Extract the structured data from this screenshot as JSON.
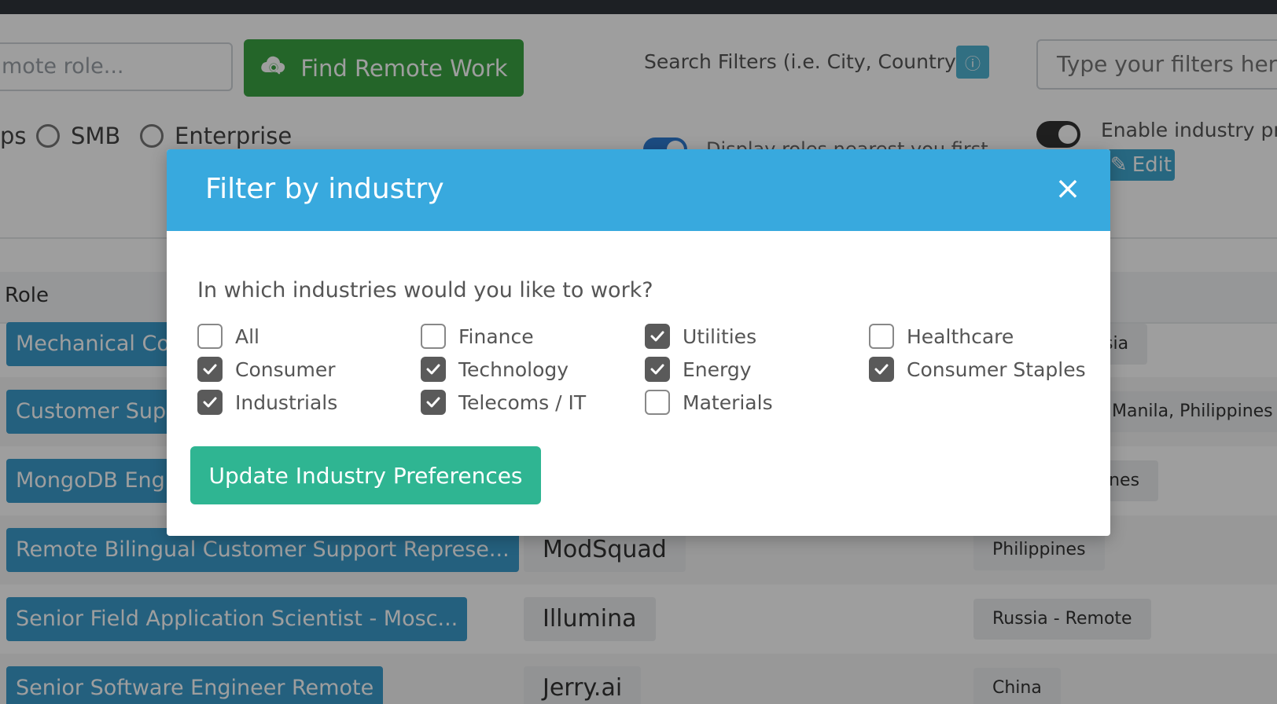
{
  "search": {
    "role_placeholder": "mote role...",
    "find_button": "Find Remote Work",
    "filters_label": "Search Filters (i.e. City, Country)",
    "filters_placeholder": "Type your filters here"
  },
  "company_size": {
    "partial_label": "ps",
    "options": [
      "SMB",
      "Enterprise"
    ]
  },
  "toggles": {
    "nearest_label": "Display roles nearest you first",
    "industry_pref_label": "Enable industry preferences",
    "edit_label": "Edit"
  },
  "table": {
    "header_role": "Role",
    "rows": [
      {
        "role": "Mechanical Con",
        "company": "",
        "location": "sia"
      },
      {
        "role": "Customer Supp",
        "company": "",
        "location": "Manila, Philippines"
      },
      {
        "role": "MongoDB Engi",
        "company": "",
        "location": "ines"
      },
      {
        "role": "Remote Bilingual Customer Support Represe...",
        "company": "ModSquad",
        "location": "Philippines"
      },
      {
        "role": "Senior Field Application Scientist - Mosc...",
        "company": "Illumina",
        "location": "Russia - Remote"
      },
      {
        "role": "Senior Software Engineer Remote",
        "company": "Jerry.ai",
        "location": "China"
      }
    ]
  },
  "modal": {
    "title": "Filter by industry",
    "close_symbol": "×",
    "question": "In which industries would you like to work?",
    "industries": [
      {
        "label": "All",
        "checked": false
      },
      {
        "label": "Finance",
        "checked": false
      },
      {
        "label": "Utilities",
        "checked": true
      },
      {
        "label": "Healthcare",
        "checked": false
      },
      {
        "label": "Consumer",
        "checked": true
      },
      {
        "label": "Technology",
        "checked": true
      },
      {
        "label": "Energy",
        "checked": true
      },
      {
        "label": "Consumer Staples",
        "checked": true
      },
      {
        "label": "Industrials",
        "checked": true
      },
      {
        "label": "Telecoms / IT",
        "checked": true
      },
      {
        "label": "Materials",
        "checked": false
      }
    ],
    "update_button": "Update Industry Preferences"
  },
  "colors": {
    "modal_header": "#38a9de",
    "find_button": "#3aa343",
    "update_button": "#2fb592",
    "role_pill": "#3b9bcc"
  }
}
